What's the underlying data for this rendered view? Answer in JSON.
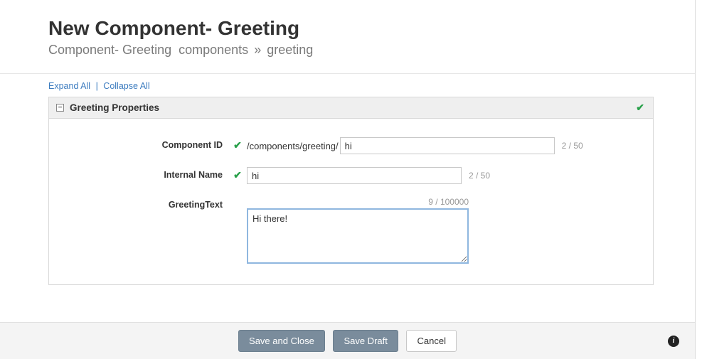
{
  "header": {
    "title": "New Component- Greeting",
    "breadcrumb": {
      "part1": "Component- Greeting",
      "part2": "components",
      "sep": "»",
      "part3": "greeting"
    }
  },
  "toolbar": {
    "expand": "Expand All",
    "collapse": "Collapse All",
    "pipe": "|"
  },
  "panel": {
    "title": "Greeting Properties",
    "collapse_glyph": "⊟"
  },
  "fields": {
    "componentId": {
      "label": "Component ID",
      "prefix": "/components/greeting/",
      "value": "hi",
      "counter": "2 / 50"
    },
    "internalName": {
      "label": "Internal Name",
      "value": "hi",
      "counter": "2 / 50"
    },
    "greetingText": {
      "label": "GreetingText",
      "value": "Hi there!",
      "counter": "9 / 100000"
    }
  },
  "footer": {
    "saveClose": "Save and Close",
    "saveDraft": "Save Draft",
    "cancel": "Cancel"
  },
  "icons": {
    "check": "✔",
    "info": "i"
  }
}
